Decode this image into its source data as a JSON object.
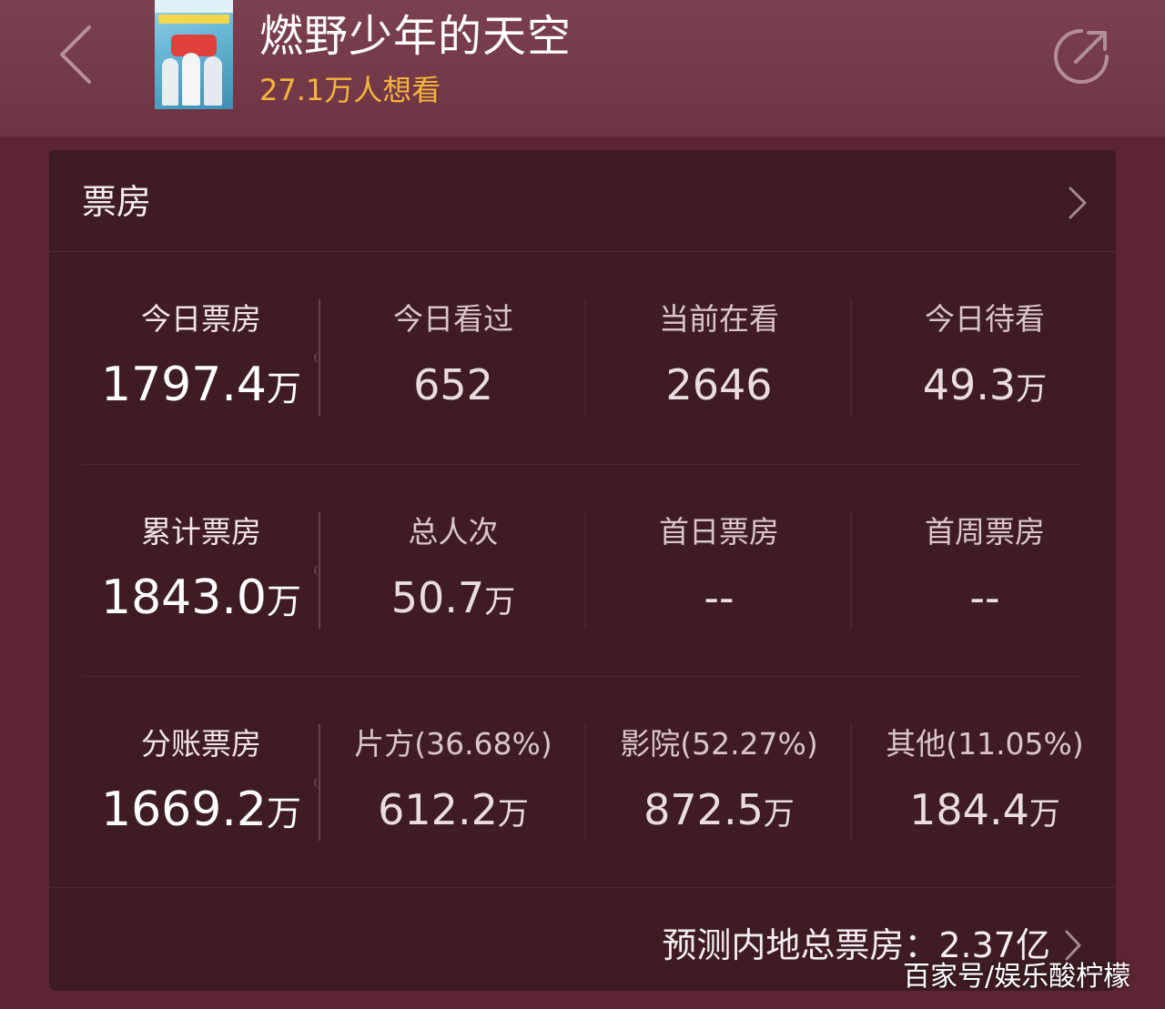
{
  "header": {
    "title": "燃野少年的天空",
    "want_to_watch": "27.1万人想看"
  },
  "box_office": {
    "section_title": "票房",
    "rows": [
      [
        {
          "label": "今日票房",
          "value": "1797.4",
          "unit": "万"
        },
        {
          "label": "今日看过",
          "value": "652",
          "unit": ""
        },
        {
          "label": "当前在看",
          "value": "2646",
          "unit": ""
        },
        {
          "label": "今日待看",
          "value": "49.3",
          "unit": "万"
        }
      ],
      [
        {
          "label": "累计票房",
          "value": "1843.0",
          "unit": "万"
        },
        {
          "label": "总人次",
          "value": "50.7",
          "unit": "万"
        },
        {
          "label": "首日票房",
          "value": "--",
          "unit": ""
        },
        {
          "label": "首周票房",
          "value": "--",
          "unit": ""
        }
      ],
      [
        {
          "label": "分账票房",
          "value": "1669.2",
          "unit": "万"
        },
        {
          "label": "片方(36.68%)",
          "value": "612.2",
          "unit": "万"
        },
        {
          "label": "影院(52.27%)",
          "value": "872.5",
          "unit": "万"
        },
        {
          "label": "其他(11.05%)",
          "value": "184.4",
          "unit": "万"
        }
      ]
    ],
    "forecast": "预测内地总票房：2.37亿"
  },
  "watermark": "百家号/娱乐酸柠檬",
  "icons": {
    "back": "chevron-left-icon",
    "share": "share-icon",
    "arrow": "chevron-right-icon"
  },
  "colors": {
    "background": "#5c2532",
    "header": "#7b4150",
    "card": "#3f1c24",
    "accent_yellow": "#f4b43b"
  }
}
